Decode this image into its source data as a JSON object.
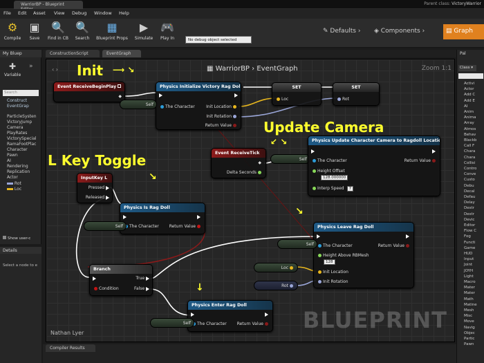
{
  "titlebar": {
    "tab": "WarriorBP - Blueprint Editor",
    "parent_label": "Parent class:",
    "parent_value": "VictoryWarrior"
  },
  "menu": [
    "File",
    "Edit",
    "Asset",
    "View",
    "Debug",
    "Window",
    "Help"
  ],
  "toolbar": {
    "buttons": [
      "Compile",
      "Save",
      "Find in CB",
      "Search",
      "Blueprint Props",
      "Simulate",
      "Play In"
    ],
    "debug_select": "No debug object selected"
  },
  "modes": [
    "Defaults",
    "Components",
    "Graph"
  ],
  "left": {
    "tab": "My Bluep",
    "variable_label": "Variable",
    "search_placeholder": "Search",
    "items": [
      "Construct",
      "EventGrap",
      "ParticleSysten",
      "VictoryJump",
      "Camera",
      "PlayRates",
      "VictorySpecial",
      "RamaFootPlac",
      "Character",
      "Pawn",
      "AI",
      "Rendering",
      "Replication",
      "Actor",
      "Rot",
      "Loc"
    ],
    "show_user": "Show user-c",
    "details_tab": "Details",
    "details_text": "Select a node to e"
  },
  "tabs": [
    "ConstructionScript",
    "EventGraph"
  ],
  "graph": {
    "breadcrumb_bp": "WarriorBP",
    "breadcrumb_graph": "EventGraph",
    "zoom": "Zoom 1:1",
    "watermark": "BLUEPRINT",
    "author": "Nathan Lyer"
  },
  "annotations": {
    "init": "Init",
    "update": "Update Camera",
    "toggle": "L Key Toggle"
  },
  "nodes": {
    "begin": {
      "title": "Event ReceiveBeginPlay"
    },
    "init": {
      "title": "Physics  Initialize Victory Rag Doll",
      "self": "Self",
      "pin": "The Character",
      "loc": "Init Location",
      "rot": "Init Rotation",
      "ret": "Return Value"
    },
    "set1": {
      "title": "SET",
      "pin": "Loc"
    },
    "set2": {
      "title": "SET",
      "pin": "Rot"
    },
    "tick": {
      "title": "Event ReceiveTick",
      "pin": "Delta Seconds"
    },
    "update": {
      "title": "Physics  Update Character Camera to Ragdoll Location",
      "self": "Self",
      "pin": "The Character",
      "ret": "Return Value",
      "height_label": "Height Offset",
      "height_val": "128.000000",
      "interp_label": "Interp Speed",
      "interp_val": "7"
    },
    "inputkey": {
      "title": "InputKey L",
      "pressed": "Pressed",
      "released": "Released"
    },
    "israg": {
      "title": "Physics  Is Rag Doll",
      "self": "Self",
      "pin": "The Character",
      "ret": "Return Value"
    },
    "leave": {
      "title": "Physics  Leave Rag Doll",
      "self": "Self",
      "pin": "The Character",
      "ret": "Return Value",
      "above_label": "Height Above RBMesh",
      "above_val": "128",
      "loc": "Init Location",
      "rot": "Init Rotation"
    },
    "branch": {
      "title": "Branch",
      "cond": "Condition",
      "t": "True",
      "f": "False"
    },
    "enter": {
      "title": "Physics  Enter Rag Doll",
      "self": "Self",
      "pin": "The Character",
      "ret": "Return Value"
    },
    "getloc": {
      "label": "Loc"
    },
    "getrot": {
      "label": "Rot"
    }
  },
  "palette": {
    "tab": "Pal",
    "class_label": "Class",
    "items": [
      "Activi",
      "Actor",
      "Add C",
      "Add E",
      "AI",
      "Anim",
      "Anima",
      "Array",
      "Atmos",
      "Behav",
      "Blackb",
      "Call F",
      "Chara",
      "Chara",
      "Collisi",
      "Contro",
      "Conve",
      "Custo",
      "Debu",
      "Decal",
      "Defau",
      "Delay",
      "Destr",
      "Destr",
      "Devic",
      "Editor",
      "Flow C",
      "Fog",
      "Functi",
      "Game",
      "HUD",
      "Input",
      "Joint",
      "JOYH",
      "Light",
      "Macro",
      "Mater",
      "Mater",
      "Math",
      "Matine",
      "Mesh",
      "Misc",
      "Move",
      "Navig",
      "Objec",
      "Partic",
      "Pawn"
    ]
  },
  "compiler": {
    "tab": "Compiler Results"
  }
}
